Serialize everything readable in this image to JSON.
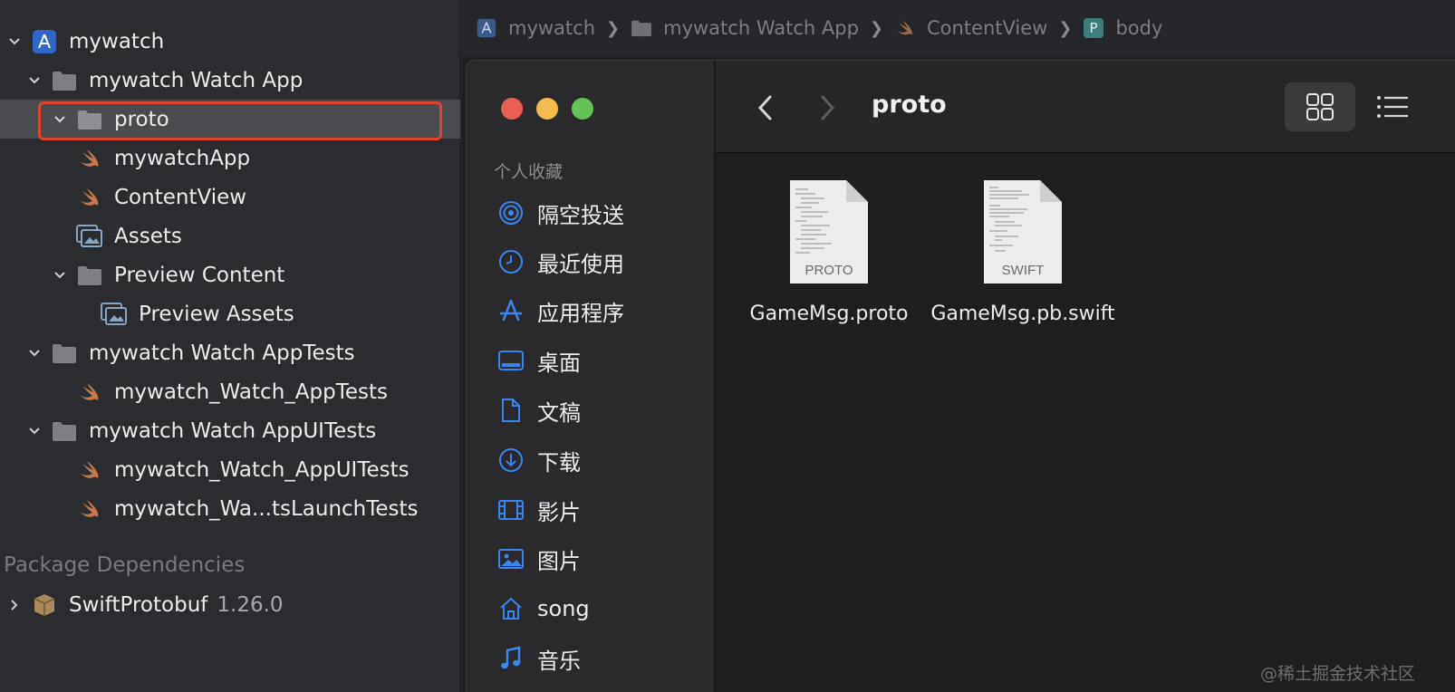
{
  "navigator": {
    "project": "mywatch",
    "group_app": "mywatch Watch App",
    "proto_folder": "proto",
    "file_app": "mywatchApp",
    "file_contentview": "ContentView",
    "file_assets": "Assets",
    "group_preview": "Preview Content",
    "file_preview_assets": "Preview Assets",
    "group_tests": "mywatch Watch AppTests",
    "file_tests": "mywatch_Watch_AppTests",
    "group_uitests": "mywatch Watch AppUITests",
    "file_uitests": "mywatch_Watch_AppUITests",
    "file_launchtests": "mywatch_Wa...tsLaunchTests",
    "package_header": "Package Dependencies",
    "package_name": "SwiftProtobuf",
    "package_version": "1.26.0"
  },
  "breadcrumb": [
    "mywatch",
    "mywatch Watch App",
    "ContentView",
    "body"
  ],
  "finder": {
    "section_title": "个人收藏",
    "sidebar": [
      "隔空投送",
      "最近使用",
      "应用程序",
      "桌面",
      "文稿",
      "下载",
      "影片",
      "图片",
      "song",
      "音乐"
    ],
    "title": "proto",
    "files": [
      {
        "name": "GameMsg.proto",
        "type": "PROTO"
      },
      {
        "name": "GameMsg.pb.swift",
        "type": "SWIFT"
      }
    ]
  },
  "watermark": "@稀土掘金技术社区",
  "colors": {
    "accent": "#3a86f0",
    "swift": "#c7784a",
    "selection_outline": "#e2432f",
    "close": "#ec5f57",
    "minimize": "#f4bd4f",
    "zoom": "#61c454"
  }
}
